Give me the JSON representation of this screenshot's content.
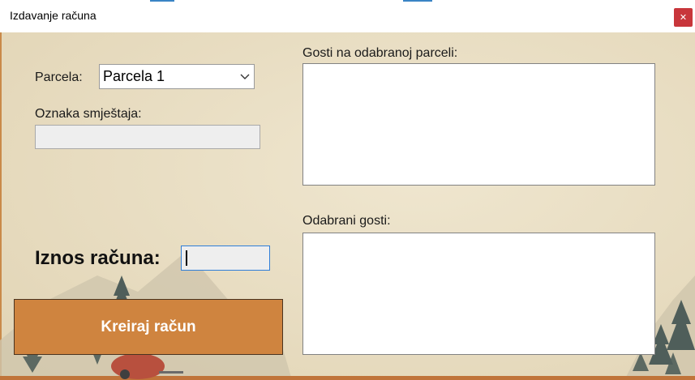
{
  "window": {
    "title": "Izdavanje računa",
    "close_glyph": "✕"
  },
  "form": {
    "parcela_label": "Parcela:",
    "parcela_selected": "Parcela 1",
    "oznaka_label": "Oznaka smještaja:",
    "oznaka_value": "",
    "iznos_label": "Iznos računa:",
    "iznos_value": "",
    "gosti_label": "Gosti na odabranoj parceli:",
    "odabrani_label": "Odabrani gosti:",
    "create_button": "Kreiraj račun"
  },
  "colors": {
    "background": "#e8ddc3",
    "button": "#cf843f",
    "close_button": "#c8363b",
    "focus_border": "#2f7ed8"
  },
  "icons": {
    "close": "close-icon",
    "dropdown": "chevron-down-icon"
  }
}
